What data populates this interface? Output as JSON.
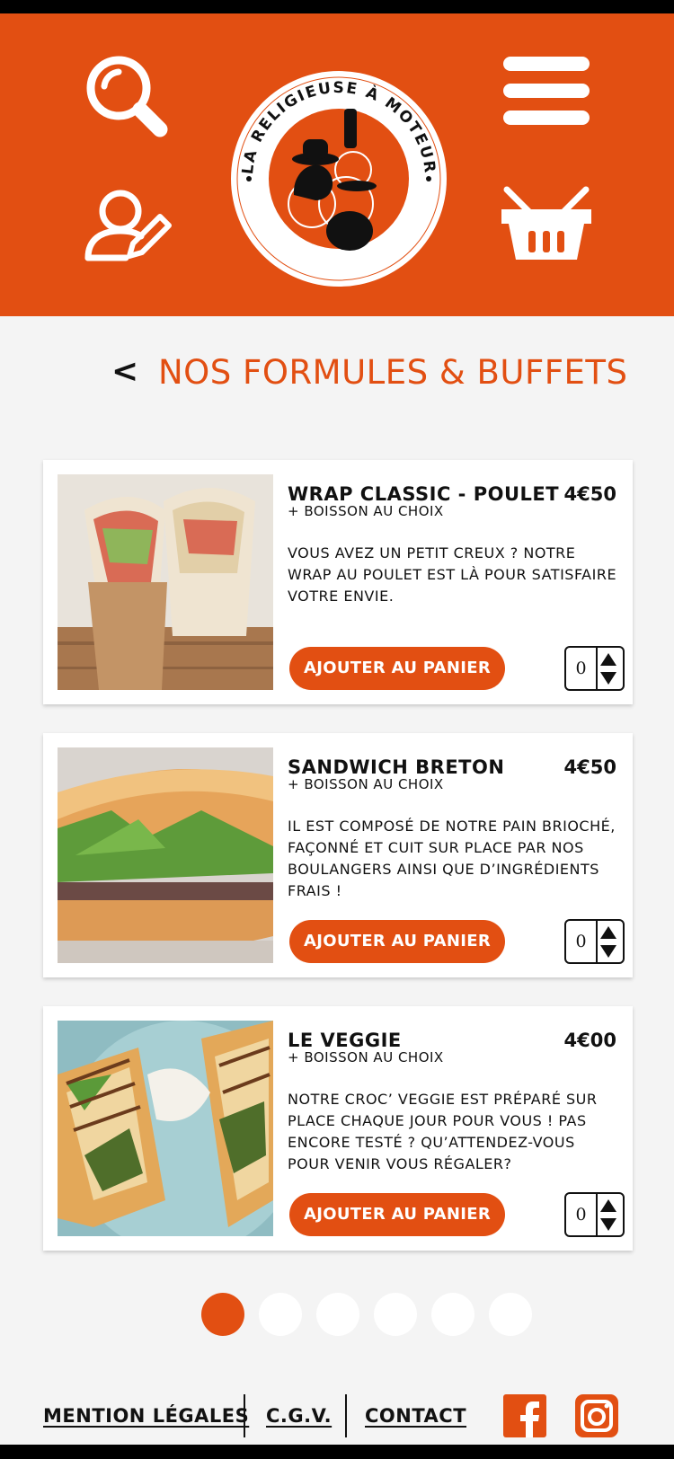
{
  "colors": {
    "accent": "#e24f12",
    "background": "#f4f4f4",
    "text": "#111111"
  },
  "header": {
    "icons": [
      "search-icon",
      "menu-icon",
      "user-edit-icon",
      "basket-icon"
    ],
    "logo": {
      "text": "LA RELIGIEUSE À MOTEUR"
    }
  },
  "page": {
    "back_label": "<",
    "title": "NOS FORMULES & BUFFETS"
  },
  "products": [
    {
      "name": "WRAP CLASSIC - POULET",
      "price": "4€50",
      "subtitle": "+ BOISSON AU CHOIX",
      "description": "VOUS AVEZ UN PETIT CREUX ? NOTRE WRAP AU POULET EST LÀ POUR SATISFAIRE VOTRE ENVIE.",
      "button": "AJOUTER AU PANIER",
      "quantity": "0"
    },
    {
      "name": "SANDWICH BRETON",
      "price": "4€50",
      "subtitle": "+ BOISSON AU CHOIX",
      "description": "IL EST COMPOSÉ DE NOTRE PAIN BRIOCHÉ, FAÇONNÉ ET CUIT SUR PLACE PAR NOS BOULANGERS AINSI QUE D’INGRÉDIENTS FRAIS !",
      "button": "AJOUTER AU PANIER",
      "quantity": "0"
    },
    {
      "name": "LE VEGGIE",
      "price": "4€00",
      "subtitle": "+ BOISSON AU CHOIX",
      "description": "NOTRE CROC’ VEGGIE EST PRÉPARÉ SUR PLACE CHAQUE JOUR POUR VOUS ! PAS ENCORE TESTÉ ? QU’ATTENDEZ-VOUS POUR VENIR VOUS RÉGALER?",
      "button": "AJOUTER AU PANIER",
      "quantity": "0"
    }
  ],
  "pagination": {
    "pages": 6,
    "current": 1
  },
  "footer": {
    "links": [
      "MENTION LÉGALES",
      "C.G.V.",
      "CONTACT"
    ],
    "social": [
      "facebook-icon",
      "instagram-icon"
    ]
  }
}
